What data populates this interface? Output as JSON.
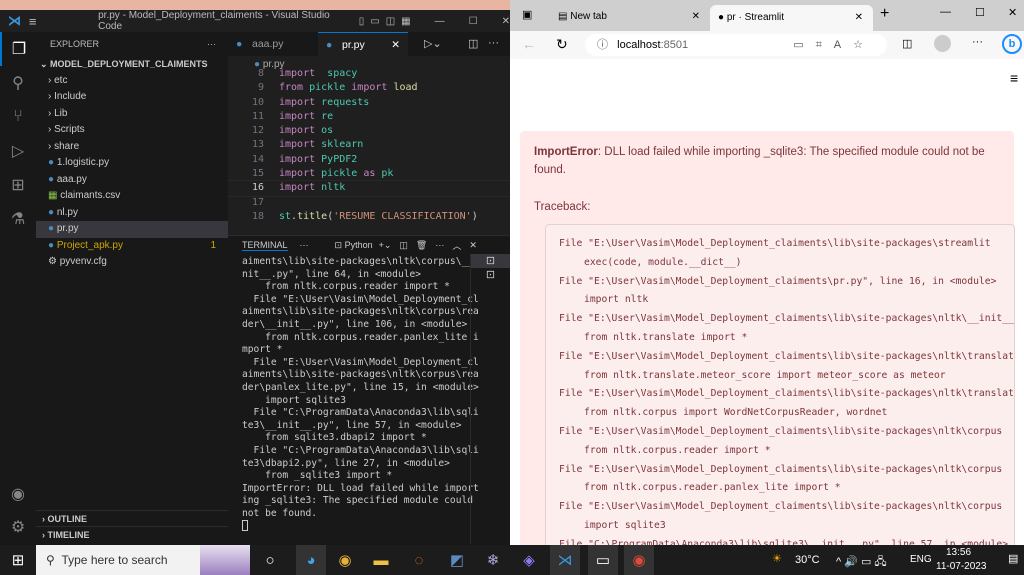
{
  "vscode": {
    "title": "pr.py - Model_Deployment_claiments - Visual Studio Code",
    "explorer_label": "EXPLORER",
    "folder": "MODEL_DEPLOYMENT_CLAIMENTS",
    "tree": [
      {
        "label": "etc",
        "type": "folder"
      },
      {
        "label": "Include",
        "type": "folder"
      },
      {
        "label": "Lib",
        "type": "folder"
      },
      {
        "label": "Scripts",
        "type": "folder"
      },
      {
        "label": "share",
        "type": "folder"
      },
      {
        "label": "1.logistic.py",
        "type": "py"
      },
      {
        "label": "aaa.py",
        "type": "py"
      },
      {
        "label": "claimants.csv",
        "type": "csv"
      },
      {
        "label": "nl.py",
        "type": "py"
      },
      {
        "label": "pr.py",
        "type": "py",
        "selected": true
      },
      {
        "label": "Project_apk.py",
        "type": "py",
        "badge": "1",
        "warn": true
      },
      {
        "label": "pyvenv.cfg",
        "type": "cfg"
      }
    ],
    "outline": "OUTLINE",
    "timeline": "TIMELINE",
    "tabs": [
      {
        "label": "aaa.py"
      },
      {
        "label": "pr.py",
        "active": true
      }
    ],
    "breadcrumb": "pr.py",
    "code": [
      {
        "n": "8",
        "t": [
          [
            "kw",
            "import"
          ],
          [
            "",
            "  "
          ],
          [
            "md",
            "spacy"
          ]
        ]
      },
      {
        "n": "9",
        "t": [
          [
            "kw",
            "from"
          ],
          [
            "",
            " "
          ],
          [
            "md",
            "pickle"
          ],
          [
            "",
            " "
          ],
          [
            "kw",
            "import"
          ],
          [
            "",
            " "
          ],
          [
            "fn",
            "load"
          ]
        ]
      },
      {
        "n": "10",
        "t": [
          [
            "kw",
            "import"
          ],
          [
            "",
            " "
          ],
          [
            "md",
            "requests"
          ]
        ]
      },
      {
        "n": "11",
        "t": [
          [
            "kw",
            "import"
          ],
          [
            "",
            " "
          ],
          [
            "md",
            "re"
          ]
        ]
      },
      {
        "n": "12",
        "t": [
          [
            "kw",
            "import"
          ],
          [
            "",
            " "
          ],
          [
            "md",
            "os"
          ]
        ]
      },
      {
        "n": "13",
        "t": [
          [
            "kw",
            "import"
          ],
          [
            "",
            " "
          ],
          [
            "md",
            "sklearn"
          ]
        ]
      },
      {
        "n": "14",
        "t": [
          [
            "kw",
            "import"
          ],
          [
            "",
            " "
          ],
          [
            "md",
            "PyPDF2"
          ]
        ]
      },
      {
        "n": "15",
        "t": [
          [
            "kw",
            "import"
          ],
          [
            "",
            " "
          ],
          [
            "md",
            "pickle"
          ],
          [
            "",
            " "
          ],
          [
            "kw",
            "as"
          ],
          [
            "",
            " "
          ],
          [
            "md",
            "pk"
          ]
        ]
      },
      {
        "n": "16",
        "t": [
          [
            "kw",
            "import"
          ],
          [
            "",
            " "
          ],
          [
            "md",
            "nltk"
          ]
        ]
      },
      {
        "n": "17",
        "t": []
      },
      {
        "n": "18",
        "t": [
          [
            "md",
            "st"
          ],
          [
            "",
            "."
          ],
          [
            "fn",
            "title"
          ],
          [
            "",
            "("
          ],
          [
            "str",
            "'RESUME CLASSIFICATION'"
          ],
          [
            "",
            ")"
          ]
        ]
      }
    ],
    "terminal": {
      "tab": "TERMINAL",
      "shell": "Python",
      "lines": [
        "aiments\\lib\\site-packages\\nltk\\corpus\\__i",
        "nit__.py\", line 64, in <module>",
        "    from nltk.corpus.reader import *",
        "  File \"E:\\User\\Vasim\\Model_Deployment_cl",
        "aiments\\lib\\site-packages\\nltk\\corpus\\rea",
        "der\\__init__.py\", line 106, in <module>",
        "    from nltk.corpus.reader.panlex_lite i",
        "mport *",
        "  File \"E:\\User\\Vasim\\Model_Deployment_cl",
        "aiments\\lib\\site-packages\\nltk\\corpus\\rea",
        "der\\panlex_lite.py\", line 15, in <module>",
        "    import sqlite3",
        "  File \"C:\\ProgramData\\Anaconda3\\lib\\sqli",
        "te3\\__init__.py\", line 57, in <module>",
        "    from sqlite3.dbapi2 import *",
        "  File \"C:\\ProgramData\\Anaconda3\\lib\\sqli",
        "te3\\dbapi2.py\", line 27, in <module>",
        "    from _sqlite3 import *",
        "ImportError: DLL load failed while import",
        "ing _sqlite3: The specified module could",
        "not be found."
      ]
    }
  },
  "browser": {
    "tabs": [
      {
        "label": "New tab"
      },
      {
        "label": "pr · Streamlit",
        "active": true
      }
    ],
    "url_host": "localhost",
    "url_port": ":8501",
    "error_type": "ImportError",
    "error_msg": ": DLL load failed while importing _sqlite3: The specified module could not be found.",
    "traceback_label": "Traceback:",
    "traceback": [
      [
        "File \"E:\\User\\Vasim\\Model_Deployment_claiments\\lib\\site-packages\\streamlit",
        "exec(code, module.__dict__)"
      ],
      [
        "File \"E:\\User\\Vasim\\Model_Deployment_claiments\\pr.py\", line 16, in <module>",
        "import nltk"
      ],
      [
        "File \"E:\\User\\Vasim\\Model_Deployment_claiments\\lib\\site-packages\\nltk\\__init__",
        "from nltk.translate import *"
      ],
      [
        "File \"E:\\User\\Vasim\\Model_Deployment_claiments\\lib\\site-packages\\nltk\\translate",
        "from nltk.translate.meteor_score import meteor_score as meteor"
      ],
      [
        "File \"E:\\User\\Vasim\\Model_Deployment_claiments\\lib\\site-packages\\nltk\\translate",
        "from nltk.corpus import WordNetCorpusReader, wordnet"
      ],
      [
        "File \"E:\\User\\Vasim\\Model_Deployment_claiments\\lib\\site-packages\\nltk\\corpus",
        "from nltk.corpus.reader import *"
      ],
      [
        "File \"E:\\User\\Vasim\\Model_Deployment_claiments\\lib\\site-packages\\nltk\\corpus",
        "from nltk.corpus.reader.panlex_lite import *"
      ],
      [
        "File \"E:\\User\\Vasim\\Model_Deployment_claiments\\lib\\site-packages\\nltk\\corpus",
        "import sqlite3"
      ],
      [
        "File \"C:\\ProgramData\\Anaconda3\\lib\\sqlite3\\__init__.py\", line 57, in <module>",
        ""
      ]
    ]
  },
  "taskbar": {
    "search_placeholder": "Type here to search",
    "weather": "30°C",
    "lang": "ENG",
    "time": "13:56",
    "date": "11-07-2023"
  }
}
